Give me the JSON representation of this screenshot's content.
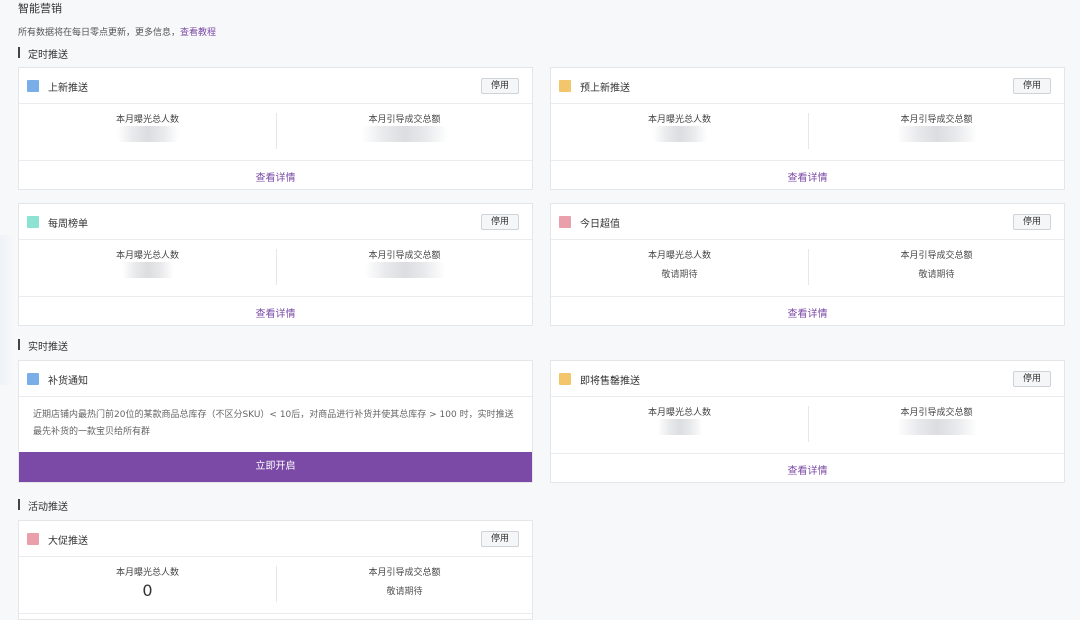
{
  "header": {
    "title": "智能营销",
    "notice_text": "所有数据将在每日零点更新，更多信息，",
    "notice_link": "查看教程"
  },
  "sections": {
    "scheduled": "定时推送",
    "realtime": "实时推送",
    "campaign": "活动推送"
  },
  "labels": {
    "stop": "停用",
    "exposure": "本月曝光总人数",
    "revenue": "本月引导成交总额",
    "details": "查看详情",
    "coming_soon": "敬请期待",
    "start_now": "立即开启"
  },
  "cards": {
    "new_arrivals": {
      "title": "上新推送"
    },
    "pre_arrivals": {
      "title": "预上新推送"
    },
    "weekly_ranking": {
      "title": "每周榜单"
    },
    "today_deals": {
      "title": "今日超值"
    },
    "restock": {
      "title": "补货通知",
      "description": "近期店铺内最热门前20位的某款商品总库存（不区分SKU）< 10后，对商品进行补货并使其总库存 > 100 时，实时推送最先补货的一款宝贝给所有群"
    },
    "sold_out_soon": {
      "title": "即将售罄推送"
    },
    "big_promo": {
      "title": "大促推送",
      "exposure_value": "0"
    }
  },
  "colors": {
    "blue": "#7aaee8",
    "yellow": "#f3c66b",
    "teal": "#8de3d3",
    "pink": "#eaa0aa",
    "accent": "#7b4aa6"
  }
}
